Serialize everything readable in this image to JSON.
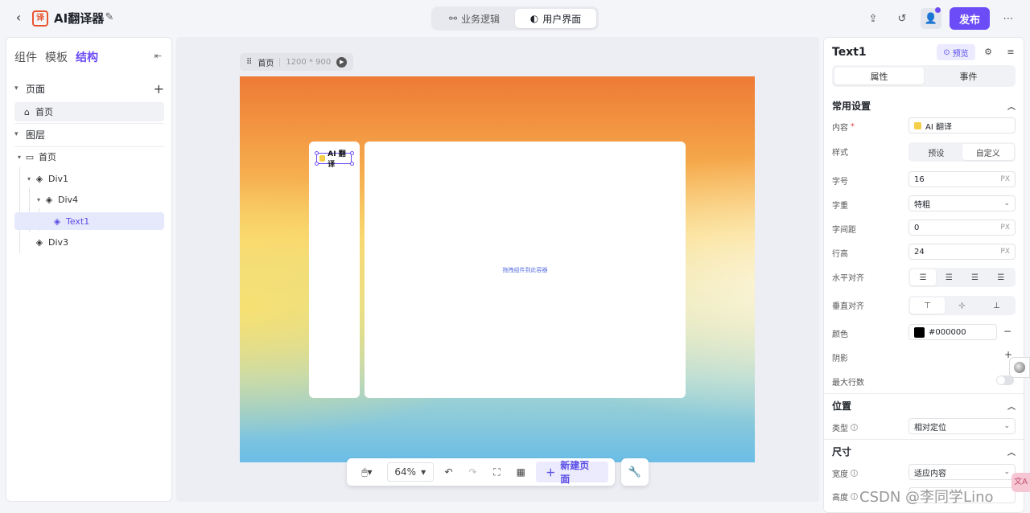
{
  "header": {
    "app_title": "AI翻译器",
    "logo_glyph": "译",
    "mode_tabs": [
      {
        "label": "业务逻辑",
        "icon": "flow-icon"
      },
      {
        "label": "用户界面",
        "icon": "palette-icon"
      }
    ],
    "active_mode": "用户界面",
    "publish_label": "发布",
    "accent_color": "#6c4cf6"
  },
  "left_panel": {
    "tabs": [
      "组件",
      "模板",
      "结构"
    ],
    "active_tab": "结构",
    "pages_section": "页面",
    "pages": [
      "首页"
    ],
    "layers_section": "图层",
    "tree": [
      {
        "label": "首页",
        "depth": 0
      },
      {
        "label": "Div1",
        "depth": 1
      },
      {
        "label": "Div4",
        "depth": 2
      },
      {
        "label": "Text1",
        "depth": 3,
        "selected": true
      },
      {
        "label": "Div3",
        "depth": 1
      }
    ]
  },
  "canvas": {
    "page_name": "首页",
    "page_size": "1200 * 900",
    "text_component": "AI 翻译",
    "drop_hint": "拖拽组件到此容器",
    "zoom": "64%",
    "new_page_label": "新建页面"
  },
  "right_panel": {
    "component_name": "Text1",
    "preview_label": "预览",
    "tabs": [
      "属性",
      "事件"
    ],
    "active_tab": "属性",
    "common_section": "常用设置",
    "content_label": "内容",
    "content_value": "AI 翻译",
    "style_label": "样式",
    "style_options": [
      "预设",
      "自定义"
    ],
    "style_active": "自定义",
    "font_size_label": "字号",
    "font_size": "16",
    "unit": "PX",
    "font_weight_label": "字重",
    "font_weight": "特粗",
    "letter_spacing_label": "字间距",
    "letter_spacing": "0",
    "line_height_label": "行高",
    "line_height": "24",
    "h_align_label": "水平对齐",
    "v_align_label": "垂直对齐",
    "color_label": "颜色",
    "color_value": "#000000",
    "shadow_label": "阴影",
    "max_lines_label": "最大行数",
    "position_section": "位置",
    "type_label": "类型",
    "type_value": "相对定位",
    "size_section": "尺寸",
    "width_label": "宽度",
    "width_value": "适应内容",
    "height_label": "高度"
  },
  "watermark": "CSDN @李同学Lino"
}
